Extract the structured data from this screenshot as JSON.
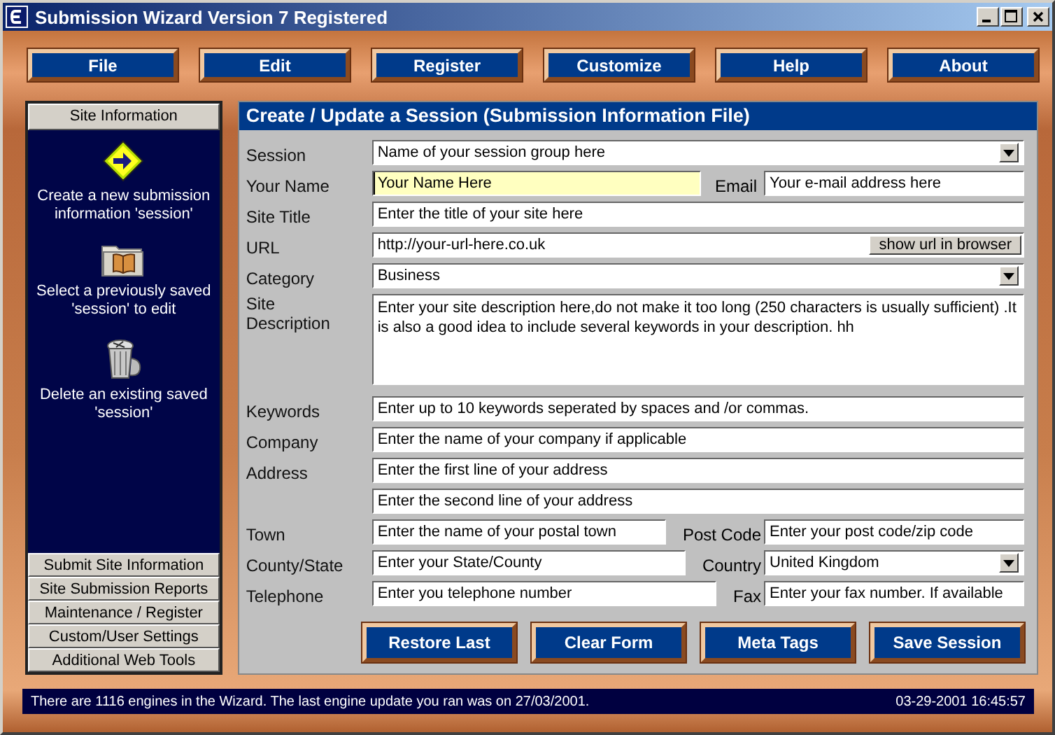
{
  "window": {
    "title": "Submission Wizard Version 7 Registered"
  },
  "menu": [
    "File",
    "Edit",
    "Register",
    "Customize",
    "Help",
    "About"
  ],
  "sidebar": {
    "header": "Site Information",
    "actions": [
      {
        "kind": "create",
        "label": "Create a new submission information 'session'"
      },
      {
        "kind": "open",
        "label": "Select a previously saved 'session' to edit"
      },
      {
        "kind": "delete",
        "label": "Delete an existing saved 'session'"
      }
    ],
    "nav": [
      "Submit Site Information",
      "Site Submission Reports",
      "Maintenance / Register",
      "Custom/User Settings",
      "Additional Web Tools"
    ]
  },
  "form": {
    "title": "Create / Update a  Session (Submission Information File)",
    "rows": [
      {
        "label": "Session",
        "field": {
          "kind": "select",
          "value": "Name of your session group here",
          "focused": false
        }
      },
      {
        "label": "Your Name",
        "field": {
          "kind": "text",
          "value": "Your Name Here",
          "focused": true
        },
        "second": {
          "label": "Email",
          "field": {
            "kind": "text",
            "value": "Your e-mail address here",
            "focused": false
          }
        }
      },
      {
        "label": "Site Title",
        "field": {
          "kind": "text",
          "value": "Enter the title of your site here",
          "focused": false
        }
      },
      {
        "label": "URL",
        "field": {
          "kind": "url",
          "value": "http://your-url-here.co.uk",
          "button": "show url in browser",
          "focused": false
        }
      },
      {
        "label": "Category",
        "field": {
          "kind": "select",
          "value": "Business",
          "focused": false
        }
      },
      {
        "label": "Site Description",
        "field": {
          "kind": "textarea",
          "value": "Enter your site description here,do not make it too long (250 characters is usually sufficient) .It is also a good idea to include several keywords in your description. hh",
          "focused": false
        }
      },
      {
        "label": "Keywords",
        "field": {
          "kind": "text",
          "value": "Enter up to 10 keywords seperated by spaces and /or commas.",
          "focused": false
        }
      },
      {
        "label": "Company",
        "field": {
          "kind": "text",
          "value": "Enter the name of your company if applicable",
          "focused": false
        }
      },
      {
        "label": "Address",
        "field": {
          "kind": "text",
          "value": "Enter the first line of your address",
          "focused": false
        }
      },
      {
        "field": {
          "kind": "text",
          "value": "Enter the second line of your address",
          "focused": false
        }
      },
      {
        "label": "Town",
        "field": {
          "kind": "text",
          "value": "Enter the name of your postal town",
          "focused": false
        },
        "second": {
          "label": "Post Code",
          "field": {
            "kind": "text",
            "value": "Enter your post code/zip code",
            "focused": false
          }
        }
      },
      {
        "label": "County/State",
        "field": {
          "kind": "text",
          "value": "Enter your State/County",
          "focused": false
        },
        "second": {
          "label": "Country",
          "field": {
            "kind": "select",
            "value": "United Kingdom",
            "focused": false
          }
        }
      },
      {
        "label": "Telephone",
        "field": {
          "kind": "text",
          "value": "Enter you telephone number",
          "focused": false
        },
        "second": {
          "label": "Fax",
          "field": {
            "kind": "text",
            "value": "Enter your fax number. If available",
            "focused": false
          }
        }
      }
    ],
    "buttons": [
      "Restore Last",
      "Clear Form",
      "Meta Tags",
      "Save Session"
    ]
  },
  "status_bar": {
    "message": "There are 1116 engines in the Wizard. The last engine update you ran was on 27/03/2001.",
    "time": "03-29-2001 16:45:57"
  }
}
